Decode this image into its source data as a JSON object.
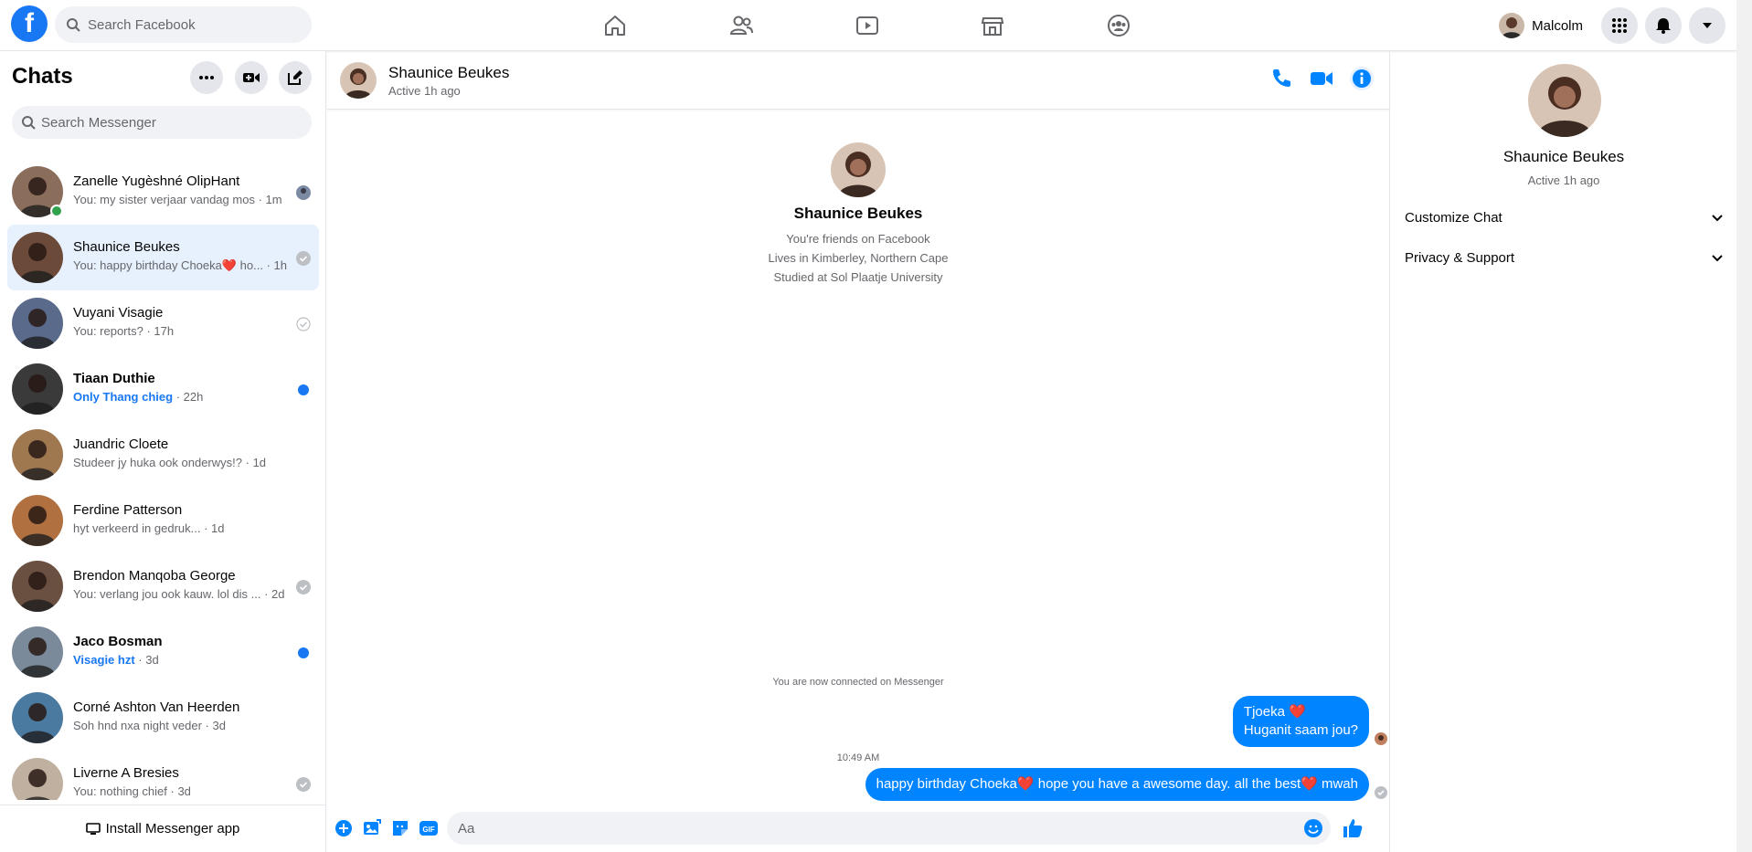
{
  "topbar": {
    "logo": "f",
    "search_placeholder": "Search Facebook",
    "nav": [
      "home-icon",
      "friends-icon",
      "watch-icon",
      "marketplace-icon",
      "groups-icon"
    ],
    "user_name": "Malcolm"
  },
  "sidebar": {
    "title": "Chats",
    "search_placeholder": "Search Messenger",
    "install_label": "Install Messenger app",
    "chats": [
      {
        "name": "Zanelle Yugèshné OlipHant",
        "preview": "You: my sister verjaar vandag mos",
        "time": "1m",
        "status": "seen-avatar",
        "online": true,
        "bold": false,
        "color": "#8b6d5c"
      },
      {
        "name": "Shaunice Beukes",
        "preview": "You: happy birthday Choeka❤️ ho...",
        "time": "1h",
        "status": "delivered",
        "online": false,
        "bold": false,
        "active": true,
        "color": "#6b4a3a"
      },
      {
        "name": "Vuyani Visagie",
        "preview": "You: reports?",
        "time": "17h",
        "status": "sent",
        "online": false,
        "bold": false,
        "color": "#5a6a8a"
      },
      {
        "name": "Tiaan Duthie",
        "preview": "Only Thang chieg",
        "time": "22h",
        "status": "unread",
        "online": false,
        "bold": true,
        "color": "#3a3a3a"
      },
      {
        "name": "Juandric Cloete",
        "preview": "Studeer jy huka ook onderwys!?",
        "time": "1d",
        "status": "none",
        "online": false,
        "bold": false,
        "color": "#a07850"
      },
      {
        "name": "Ferdine Patterson",
        "preview": "hyt verkeerd in gedruk...",
        "time": "1d",
        "status": "none",
        "online": false,
        "bold": false,
        "color": "#b07040"
      },
      {
        "name": "Brendon Manqoba George",
        "preview": "You: verlang jou ook kauw. lol dis ...",
        "time": "2d",
        "status": "delivered",
        "online": false,
        "bold": false,
        "color": "#6a5040"
      },
      {
        "name": "Jaco Bosman",
        "preview": "Visagie hzt",
        "time": "3d",
        "status": "unread",
        "online": false,
        "bold": true,
        "color": "#7a8a9a"
      },
      {
        "name": "Corné Ashton Van Heerden",
        "preview": "Soh hnd nxa night veder",
        "time": "3d",
        "status": "none",
        "online": false,
        "bold": false,
        "color": "#4a7aa0"
      },
      {
        "name": "Liverne A Bresies",
        "preview": "You: nothing chief",
        "time": "3d",
        "status": "delivered",
        "online": false,
        "bold": false,
        "color": "#c0b0a0"
      }
    ]
  },
  "conversation": {
    "name": "Shaunice Beukes",
    "status": "Active 1h ago",
    "intro_name": "Shaunice Beukes",
    "intro_lines": [
      "You're friends on Facebook",
      "Lives in Kimberley, Northern Cape",
      "Studied at Sol Plaatje University"
    ],
    "system_message": "You are now connected on Messenger",
    "messages": [
      {
        "line1": "Tjoeka ❤️",
        "line2": "Huganit saam jou?"
      },
      {
        "time": "10:49 AM",
        "text": "happy birthday Choeka❤️ hope you have a awesome day. all the best❤️ mwah"
      }
    ],
    "composer_placeholder": "Aa"
  },
  "info_panel": {
    "name": "Shaunice Beukes",
    "status": "Active 1h ago",
    "sections": [
      "Customize Chat",
      "Privacy & Support"
    ]
  },
  "colors": {
    "accent": "#1877f2",
    "bubble": "#0084ff",
    "active_chat": "#e7f0fd"
  }
}
